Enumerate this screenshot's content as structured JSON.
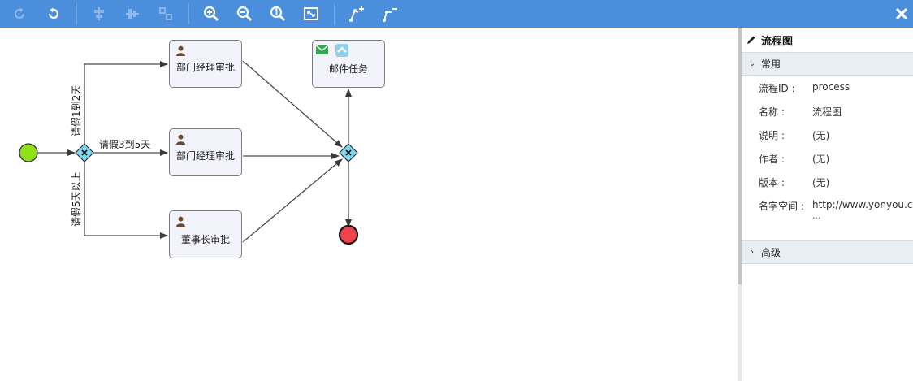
{
  "toolbar": {
    "buttons": [
      {
        "name": "redo-icon",
        "enabled": false
      },
      {
        "name": "undo-icon",
        "enabled": true
      },
      {
        "name": "align-horizontal-icon",
        "enabled": false
      },
      {
        "name": "align-vertical-icon",
        "enabled": false
      },
      {
        "name": "same-size-icon",
        "enabled": false
      },
      {
        "name": "zoom-in-icon",
        "enabled": true
      },
      {
        "name": "zoom-out-icon",
        "enabled": true
      },
      {
        "name": "zoom-actual-icon",
        "enabled": true
      },
      {
        "name": "zoom-fit-icon",
        "enabled": true
      },
      {
        "name": "add-bendpoint-icon",
        "enabled": true
      },
      {
        "name": "remove-bendpoint-icon",
        "enabled": true
      }
    ],
    "close_icon": "close-icon"
  },
  "diagram": {
    "tasks": {
      "manager_approval_1": "部门经理审批",
      "manager_approval_2": "部门经理审批",
      "chairman_approval": "董事长审批",
      "mail_task": "邮件任务"
    },
    "flows": {
      "leave_1_2": "请假1到2天",
      "leave_3_5": "请假3到5天",
      "leave_5_plus": "请假5天以上"
    },
    "colors": {
      "start_event": "#8ee01a",
      "end_event": "#f2424b",
      "gateway": "#7fd6f0",
      "task_fill": "#f2f3fb",
      "toolbar": "#4a8edc"
    }
  },
  "panel": {
    "title": "流程图",
    "section_general": "常用",
    "section_advanced": "高级",
    "properties": [
      {
        "key": "流程ID :",
        "value": "process"
      },
      {
        "key": "名称 :",
        "value": "流程图"
      },
      {
        "key": "说明 :",
        "value": "(无)"
      },
      {
        "key": "作者 :",
        "value": "(无)"
      },
      {
        "key": "版本 :",
        "value": "(无)"
      },
      {
        "key": "名字空间 :",
        "value": "http://www.yonyou.com",
        "more": "..."
      }
    ]
  }
}
